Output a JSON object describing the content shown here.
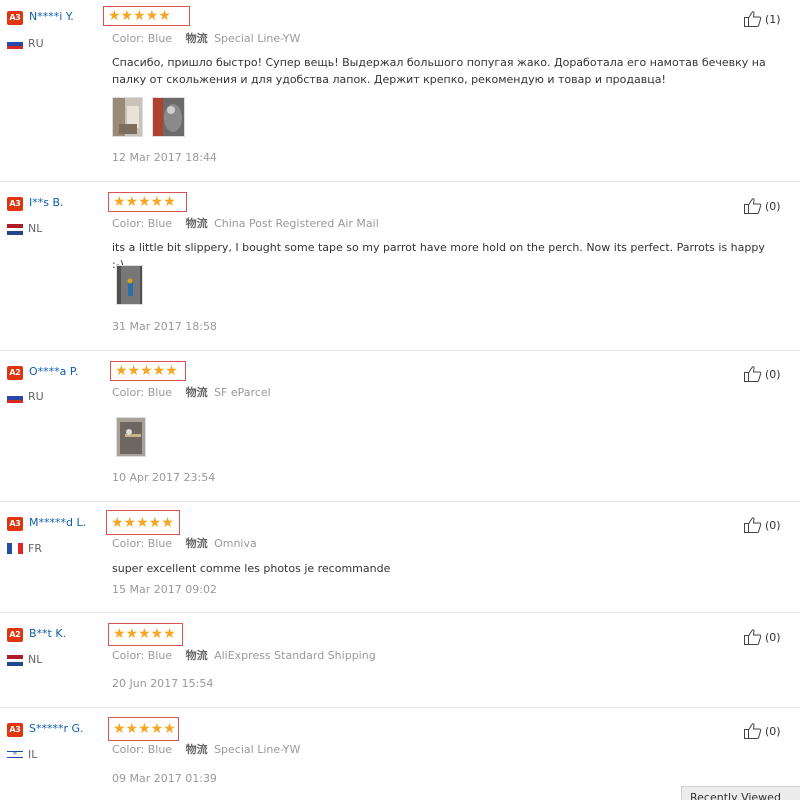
{
  "labels": {
    "color": "Color:",
    "shipping": "物流"
  },
  "reviews": [
    {
      "level": "A3",
      "user": "N****i Y.",
      "country": "RU",
      "stars": "★★★★★",
      "color": "Blue",
      "shipping": "Special Line-YW",
      "text": "Спасибо, пришло быстро! Супер вещь! Выдержал большого попугая жако. Доработала его намотав бечевку на палку от скольжения и для удобства лапок. Держит крепко, рекомендую и товар и продавца!",
      "date": "12 Mar 2017 18:44",
      "helpful": "(1)",
      "rating": 5
    },
    {
      "level": "A3",
      "user": "I**s B.",
      "country": "NL",
      "stars": "★★★★★",
      "color": "Blue",
      "shipping": "China Post Registered Air Mail",
      "text": "its a little bit slippery, I bought some tape so my parrot have more hold on the perch. Now its perfect. Parrots is happy :-)",
      "date": "31 Mar 2017 18:58",
      "helpful": "(0)",
      "rating": 5
    },
    {
      "level": "A2",
      "user": "O****a P.",
      "country": "RU",
      "stars": "★★★★★",
      "color": "Blue",
      "shipping": "SF eParcel",
      "text": "",
      "date": "10 Apr 2017 23:54",
      "helpful": "(0)",
      "rating": 5
    },
    {
      "level": "A3",
      "user": "M*****d L.",
      "country": "FR",
      "stars": "★★★★★",
      "color": "Blue",
      "shipping": "Omniva",
      "text": "super excellent comme les photos je recommande",
      "date": "15 Mar 2017 09:02",
      "helpful": "(0)",
      "rating": 5
    },
    {
      "level": "A2",
      "user": "B**t K.",
      "country": "NL",
      "stars": "★★★★★",
      "color": "Blue",
      "shipping": "AliExpress Standard Shipping",
      "text": "",
      "date": "20 Jun 2017 15:54",
      "helpful": "(0)",
      "rating": 5
    },
    {
      "level": "A3",
      "user": "S*****r G.",
      "country": "IL",
      "stars": "★★★★★",
      "color": "Blue",
      "shipping": "Special Line-YW",
      "text": "",
      "date": "09 Mar 2017 01:39",
      "helpful": "(0)",
      "rating": 5
    }
  ],
  "recently_viewed": "Recently Viewed",
  "colors": {
    "badge": "#e0360f",
    "user_link": "#0d5eaf",
    "star": "#f5a623",
    "highlight_box": "#d9534f"
  },
  "icons": {
    "helpful": "thumbs-up-icon"
  }
}
